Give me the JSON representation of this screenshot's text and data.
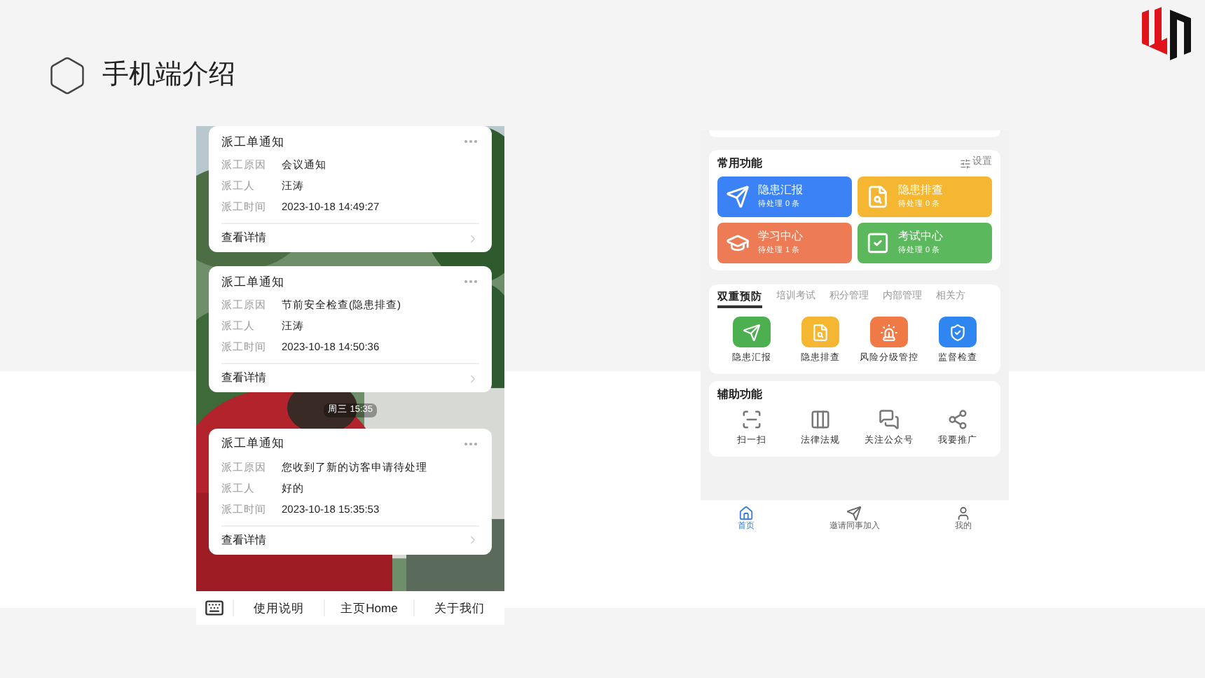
{
  "header": {
    "title": "手机端介绍"
  },
  "left_phone": {
    "cards": [
      {
        "title": "派工单通知",
        "rows": [
          {
            "label": "派工原因",
            "value": "会议通知"
          },
          {
            "label": "派工人",
            "value": "汪涛"
          },
          {
            "label": "派工时间",
            "value": "2023-10-18 14:49:27"
          }
        ],
        "link": "查看详情"
      },
      {
        "title": "派工单通知",
        "rows": [
          {
            "label": "派工原因",
            "value": "节前安全检查(隐患排查)"
          },
          {
            "label": "派工人",
            "value": "汪涛"
          },
          {
            "label": "派工时间",
            "value": "2023-10-18 14:50:36"
          }
        ],
        "link": "查看详情"
      },
      {
        "title": "派工单通知",
        "rows": [
          {
            "label": "派工原因",
            "value": "您收到了新的访客申请待处理"
          },
          {
            "label": "派工人",
            "value": "好的"
          },
          {
            "label": "派工时间",
            "value": "2023-10-18 15:35:53"
          }
        ],
        "link": "查看详情"
      }
    ],
    "timestamp": "周三 15:35",
    "bottom_bar": [
      "使用说明",
      "主页Home",
      "关于我们"
    ]
  },
  "right_phone": {
    "common": {
      "title": "常用功能",
      "settings": "设置",
      "tiles": [
        {
          "kind": "send",
          "title": "隐患汇报",
          "sub": "待处理 0 条",
          "color": "#3b82f6"
        },
        {
          "kind": "search",
          "title": "隐患排查",
          "sub": "待处理 0 条",
          "color": "#f5b731"
        },
        {
          "kind": "study",
          "title": "学习中心",
          "sub": "待处理 1 条",
          "color": "#ec7b56"
        },
        {
          "kind": "exam",
          "title": "考试中心",
          "sub": "待处理 0 条",
          "color": "#5cb85c"
        }
      ]
    },
    "tabs": [
      {
        "label": "双重预防",
        "selected": true
      },
      {
        "label": "培训考试",
        "selected": false
      },
      {
        "label": "积分管理",
        "selected": false
      },
      {
        "label": "内部管理",
        "selected": false
      },
      {
        "label": "相关方",
        "selected": false
      }
    ],
    "features": [
      {
        "kind": "send",
        "label": "隐患汇报",
        "color": "#4caf50"
      },
      {
        "kind": "search",
        "label": "隐患排查",
        "color": "#f5b731"
      },
      {
        "kind": "alarm",
        "label": "风险分级管控",
        "color": "#f07a45"
      },
      {
        "kind": "shield",
        "label": "监督检查",
        "color": "#2f86f0"
      }
    ],
    "aux": {
      "title": "辅助功能",
      "items": [
        {
          "kind": "scan",
          "label": "扫一扫"
        },
        {
          "kind": "books",
          "label": "法律法规"
        },
        {
          "kind": "chat",
          "label": "关注公众号"
        },
        {
          "kind": "share",
          "label": "我要推广"
        }
      ]
    },
    "nav": [
      {
        "kind": "home",
        "label": "首页",
        "selected": true
      },
      {
        "kind": "send",
        "label": "邀请同事加入",
        "selected": false
      },
      {
        "kind": "user",
        "label": "我的",
        "selected": false
      }
    ]
  }
}
